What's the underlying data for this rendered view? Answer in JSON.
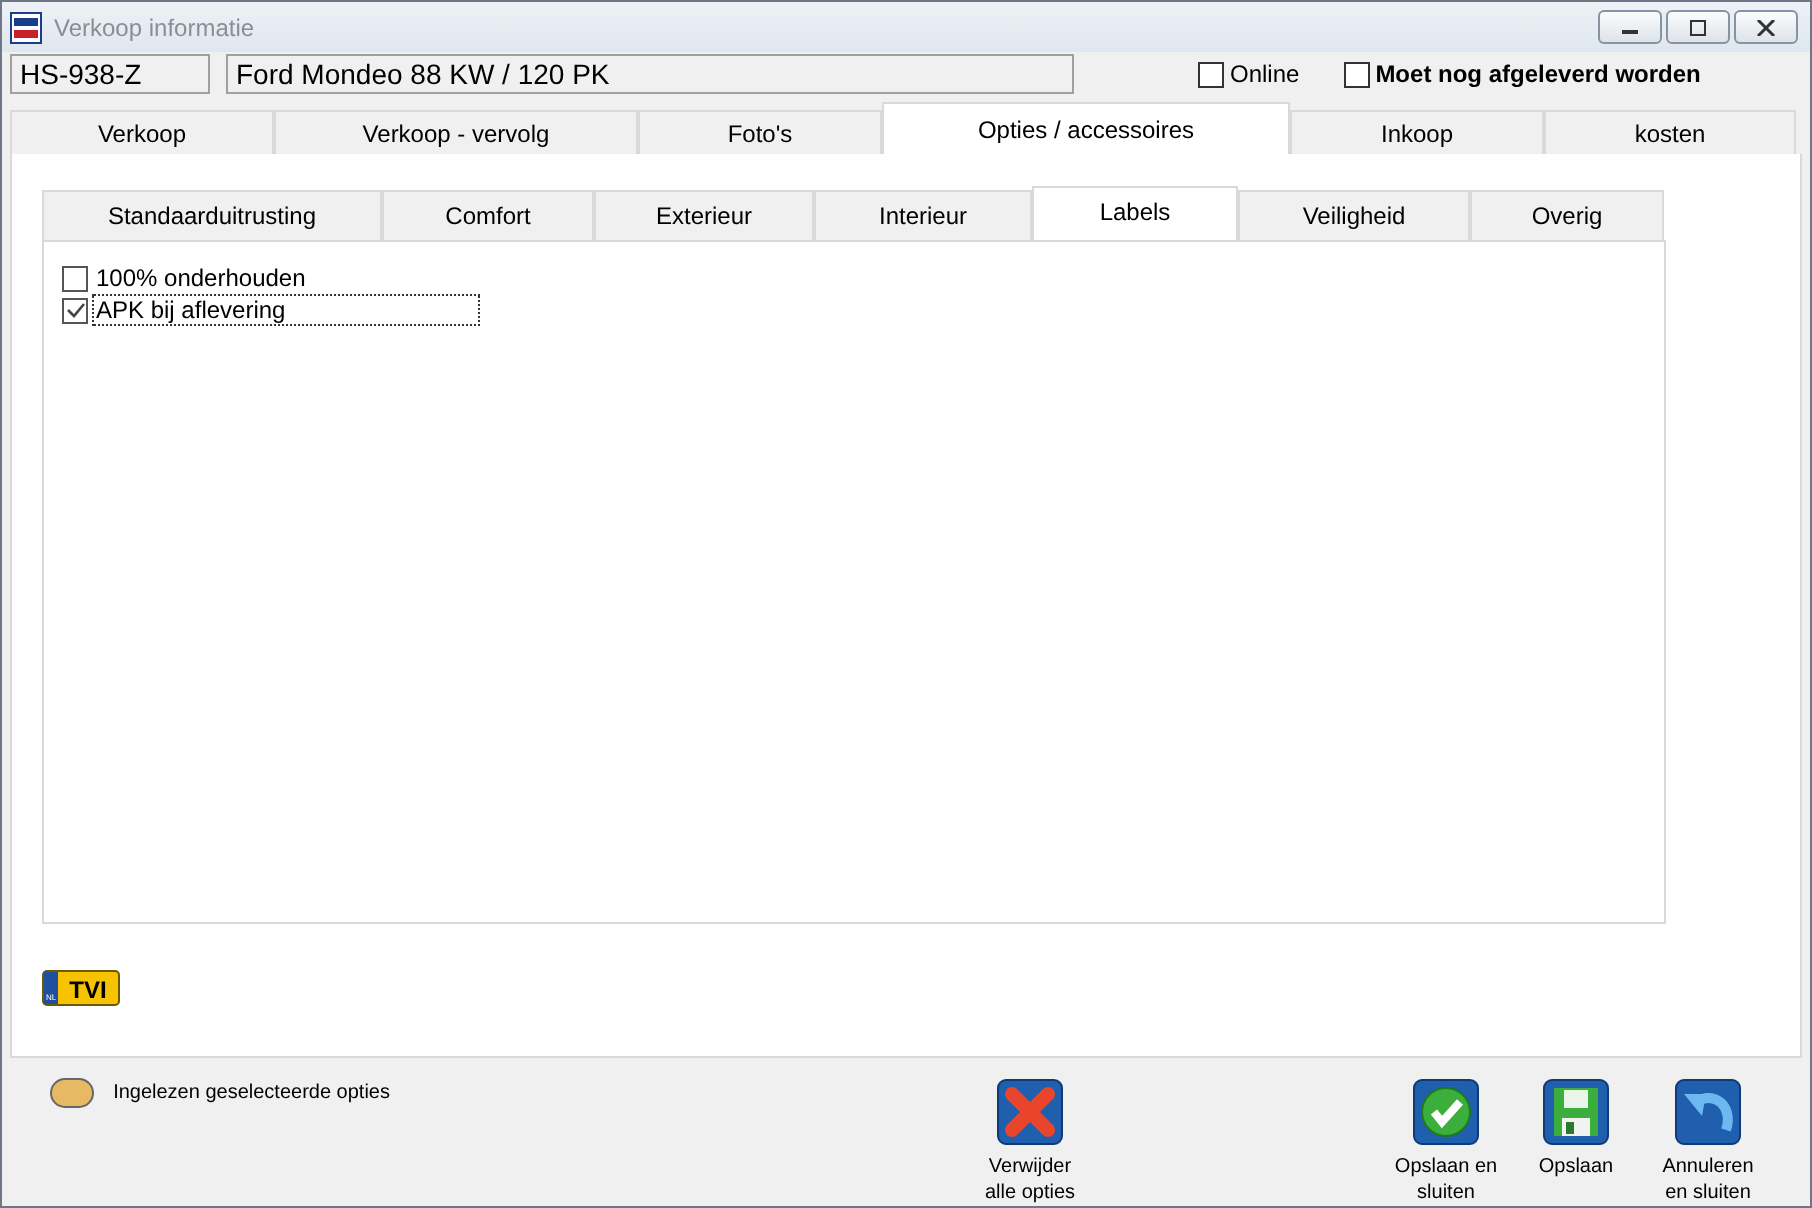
{
  "window": {
    "title": "Verkoop informatie"
  },
  "header": {
    "plate": "HS-938-Z",
    "description": "Ford Mondeo 88 KW / 120 PK",
    "checkboxes": [
      {
        "label": "Online",
        "checked": false,
        "bold": false
      },
      {
        "label": "Moet nog afgeleverd worden",
        "checked": false,
        "bold": true
      }
    ]
  },
  "tabs": [
    {
      "label": "Verkoop",
      "selected": false
    },
    {
      "label": "Verkoop - vervolg",
      "selected": false
    },
    {
      "label": "Foto's",
      "selected": false
    },
    {
      "label": "Opties / accessoires",
      "selected": true
    },
    {
      "label": "Inkoop",
      "selected": false
    },
    {
      "label": "kosten",
      "selected": false
    }
  ],
  "subtabs": [
    {
      "label": "Standaarduitrusting",
      "selected": false
    },
    {
      "label": "Comfort",
      "selected": false
    },
    {
      "label": "Exterieur",
      "selected": false
    },
    {
      "label": "Interieur",
      "selected": false
    },
    {
      "label": "Labels",
      "selected": true
    },
    {
      "label": "Veiligheid",
      "selected": false
    },
    {
      "label": "Overig",
      "selected": false
    }
  ],
  "options": [
    {
      "label": "100% onderhouden",
      "checked": false,
      "focused": false
    },
    {
      "label": "APK bij aflevering",
      "checked": true,
      "focused": true
    }
  ],
  "logo": {
    "country": "NL",
    "text": "TVI"
  },
  "legend": {
    "color": "#e8b964",
    "label": "Ingelezen geselecteerde opties"
  },
  "buttons": [
    {
      "kind": "delete",
      "label": "Verwijder alle opties"
    },
    {
      "kind": "save-close",
      "label": "Opslaan en sluiten"
    },
    {
      "kind": "save",
      "label": "Opslaan"
    },
    {
      "kind": "cancel",
      "label": "Annuleren en sluiten"
    }
  ]
}
